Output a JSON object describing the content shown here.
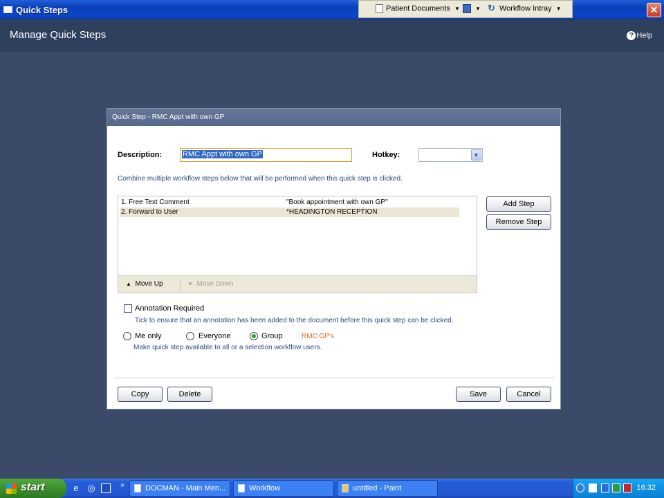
{
  "window": {
    "title": "Quick Steps",
    "close_label": "✕"
  },
  "launcher": {
    "patient_documents": "Patient Documents",
    "workflow_intray": "Workflow Intray"
  },
  "header": {
    "title": "Manage Quick Steps",
    "help": "Help"
  },
  "dialog": {
    "title": "Quick Step - RMC Appt with own GP",
    "description_label": "Description:",
    "description_value": "RMC Appt with own GP",
    "hotkey_label": "Hotkey:",
    "hotkey_value": "",
    "combine_hint": "Combine multiple workflow steps below that will be performed when this quick step is clicked.",
    "steps": [
      {
        "name": "1. Free Text Comment",
        "detail": "\"Book appointment with own GP\""
      },
      {
        "name": "2. Forward to User",
        "detail": "*HEADINGTON RECEPTION"
      }
    ],
    "move_up": "Move Up",
    "move_down": "Move Down",
    "add_step": "Add Step",
    "remove_step": "Remove Step",
    "annotation_label": "Annotation Required",
    "annotation_checked": false,
    "annotation_hint": "Tick to ensure that an annotation has been added to the document before this quick step can be clicked.",
    "availability": {
      "options": [
        "Me only",
        "Everyone",
        "Group"
      ],
      "selected": "Group",
      "group_name": "RMC GP's",
      "hint": "Make quick step available to all or a selection workflow users."
    },
    "buttons": {
      "copy": "Copy",
      "delete": "Delete",
      "save": "Save",
      "cancel": "Cancel"
    }
  },
  "taskbar": {
    "start": "start",
    "tasks": [
      "DOCMAN - Main Men...",
      "Workflow",
      "untitled - Paint"
    ],
    "clock": "16:32"
  }
}
